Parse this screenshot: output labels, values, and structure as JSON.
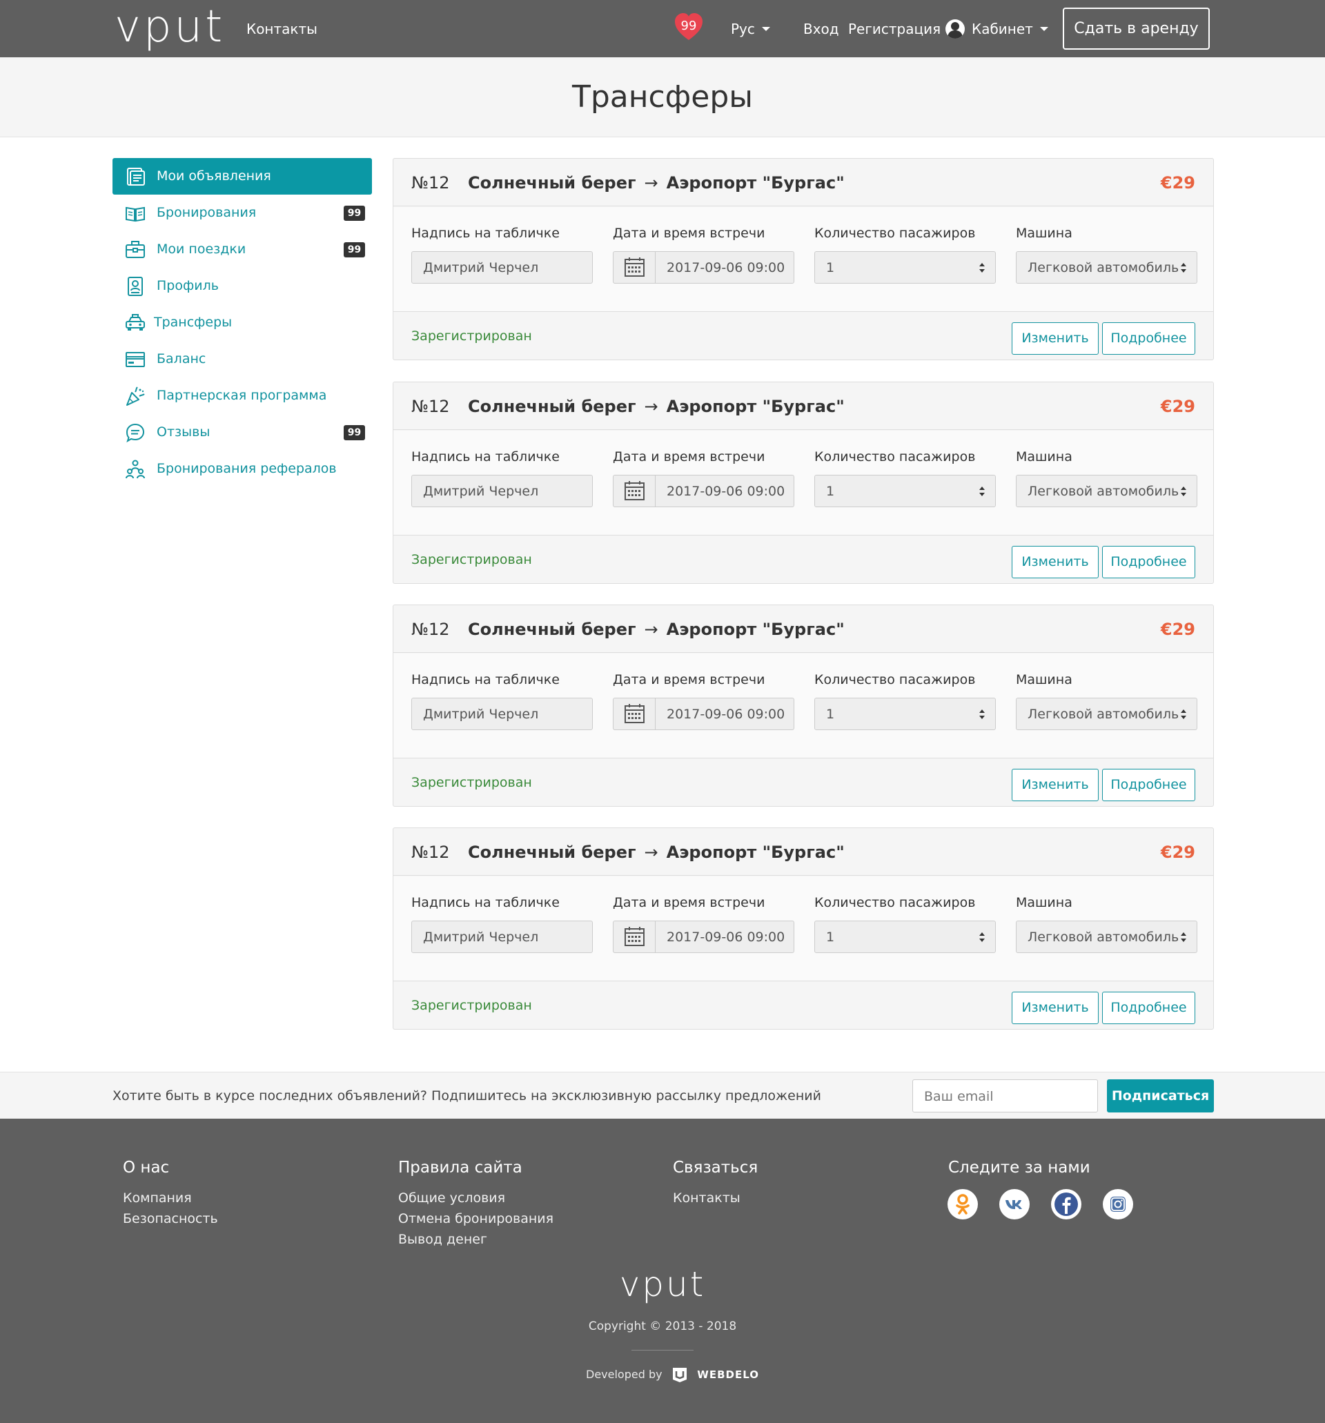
{
  "header": {
    "logo": "vput",
    "contacts": "Контакты",
    "favorites_count": "99",
    "language": "Рус",
    "login": "Вход",
    "register": "Регистрация",
    "cabinet": "Кабинет",
    "rent_button": "Сдать в аренду"
  },
  "page_title": "Трансферы",
  "sidebar": {
    "items": [
      {
        "label": "Мои объявления",
        "icon": "listings-icon",
        "badge": "",
        "active": true
      },
      {
        "label": "Бронирования",
        "icon": "book-icon",
        "badge": "99"
      },
      {
        "label": "Мои поездки",
        "icon": "suitcase-icon",
        "badge": "99"
      },
      {
        "label": "Профиль",
        "icon": "profile-card-icon",
        "badge": ""
      },
      {
        "label": "Трансферы",
        "icon": "taxi-icon",
        "badge": ""
      },
      {
        "label": "Баланс",
        "icon": "wallet-icon",
        "badge": ""
      },
      {
        "label": "Партнерская программа",
        "icon": "party-popper-icon",
        "badge": ""
      },
      {
        "label": "Отзывы",
        "icon": "chat-bubble-icon",
        "badge": "99"
      },
      {
        "label": "Бронирования рефералов",
        "icon": "referrals-icon",
        "badge": ""
      }
    ]
  },
  "transfers": [
    {
      "number": "№12",
      "from": "Солнечный берег",
      "arrow": "→",
      "to": "Аэропорт \"Бургас\"",
      "price": "€29",
      "sign_label": "Надпись на табличке",
      "sign_value": "Дмитрий Черчел",
      "datetime_label": "Дата и время встречи",
      "datetime_value": "2017-09-06 09:00",
      "passengers_label": "Количество пасажиров",
      "passengers_value": "1",
      "car_label": "Машина",
      "car_value": "Легковой автомобиль",
      "status": "Зарегистрирован",
      "edit": "Изменить",
      "details": "Подробнее"
    },
    {
      "number": "№12",
      "from": "Солнечный берег",
      "arrow": "→",
      "to": "Аэропорт \"Бургас\"",
      "price": "€29",
      "sign_label": "Надпись на табличке",
      "sign_value": "Дмитрий Черчел",
      "datetime_label": "Дата и время встречи",
      "datetime_value": "2017-09-06 09:00",
      "passengers_label": "Количество пасажиров",
      "passengers_value": "1",
      "car_label": "Машина",
      "car_value": "Легковой автомобиль",
      "status": "Зарегистрирован",
      "edit": "Изменить",
      "details": "Подробнее"
    },
    {
      "number": "№12",
      "from": "Солнечный берег",
      "arrow": "→",
      "to": "Аэропорт \"Бургас\"",
      "price": "€29",
      "sign_label": "Надпись на табличке",
      "sign_value": "Дмитрий Черчел",
      "datetime_label": "Дата и время встречи",
      "datetime_value": "2017-09-06 09:00",
      "passengers_label": "Количество пасажиров",
      "passengers_value": "1",
      "car_label": "Машина",
      "car_value": "Легковой автомобиль",
      "status": "Зарегистрирован",
      "edit": "Изменить",
      "details": "Подробнее"
    },
    {
      "number": "№12",
      "from": "Солнечный берег",
      "arrow": "→",
      "to": "Аэропорт \"Бургас\"",
      "price": "€29",
      "sign_label": "Надпись на табличке",
      "sign_value": "Дмитрий Черчел",
      "datetime_label": "Дата и время встречи",
      "datetime_value": "2017-09-06 09:00",
      "passengers_label": "Количество пасажиров",
      "passengers_value": "1",
      "car_label": "Машина",
      "car_value": "Легковой автомобиль",
      "status": "Зарегистрирован",
      "edit": "Изменить",
      "details": "Подробнее"
    }
  ],
  "subscribe": {
    "text": "Хотите быть в курсе последних объявлений? Подпишитесь на эксклюзивную рассылку предложений",
    "placeholder": "Ваш email",
    "button": "Подписаться"
  },
  "footer": {
    "about": {
      "title": "О нас",
      "links": [
        "Компания",
        "Безопасность"
      ]
    },
    "rules": {
      "title": "Правила сайта",
      "links": [
        "Общие условия",
        "Отмена бронирования",
        "Вывод денег"
      ]
    },
    "contact": {
      "title": "Связаться",
      "links": [
        "Контакты"
      ]
    },
    "follow": {
      "title": "Следите за нами",
      "socials": [
        "odnoklassniki-icon",
        "vk-icon",
        "facebook-icon",
        "instagram-icon"
      ]
    },
    "logo": "vput",
    "copyright": "Copyright © 2013 - 2018",
    "developed_by": "Developed by",
    "developer": "WEBDELO"
  },
  "colors": {
    "accent": "#0b98a5",
    "header_bg": "#5f5f5f",
    "price": "#e8623f",
    "status_ok": "#3a8a3a",
    "heart": "#e8434f"
  }
}
